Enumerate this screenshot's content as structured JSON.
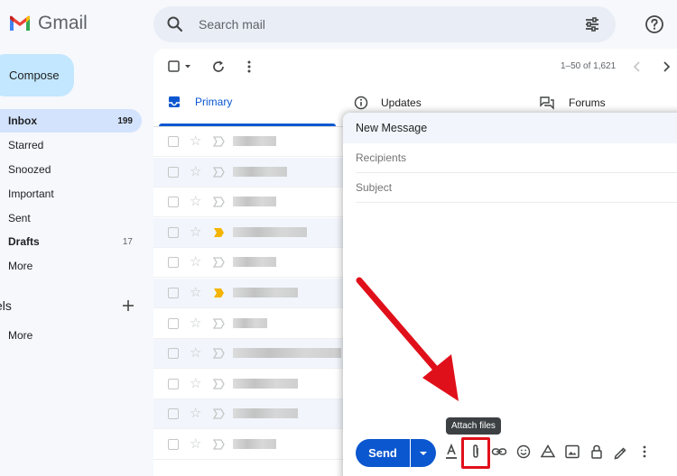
{
  "app": {
    "name": "Gmail"
  },
  "search": {
    "placeholder": "Search mail"
  },
  "nav": {
    "compose_label": "Compose",
    "items": [
      {
        "label": "Inbox",
        "count": "199"
      },
      {
        "label": "Starred",
        "count": ""
      },
      {
        "label": "Snoozed",
        "count": ""
      },
      {
        "label": "Important",
        "count": ""
      },
      {
        "label": "Sent",
        "count": ""
      },
      {
        "label": "Drafts",
        "count": "17"
      },
      {
        "label": "More",
        "count": ""
      }
    ],
    "labels_header": "els",
    "labels_more": "More"
  },
  "toolbar": {
    "pager": "1–50 of 1,621"
  },
  "tabs": [
    {
      "label": "Primary",
      "icon": "inbox-icon"
    },
    {
      "label": "Updates",
      "icon": "info-icon"
    },
    {
      "label": "Forums",
      "icon": "forum-icon"
    }
  ],
  "rows": [
    {
      "important": false
    },
    {
      "important": false
    },
    {
      "important": false
    },
    {
      "important": true
    },
    {
      "important": false
    },
    {
      "important": true
    },
    {
      "important": false
    },
    {
      "important": false
    },
    {
      "important": false
    },
    {
      "important": false
    },
    {
      "important": false
    }
  ],
  "compose_window": {
    "title": "New Message",
    "recipients_placeholder": "Recipients",
    "subject_placeholder": "Subject",
    "send_label": "Send",
    "tooltip": "Attach files"
  },
  "colors": {
    "accent": "#0b57d0",
    "compose_bg": "#c2e7ff",
    "active_nav": "#d3e3fd",
    "important_marker": "#f4b400",
    "annotation_red": "#e0101a"
  }
}
